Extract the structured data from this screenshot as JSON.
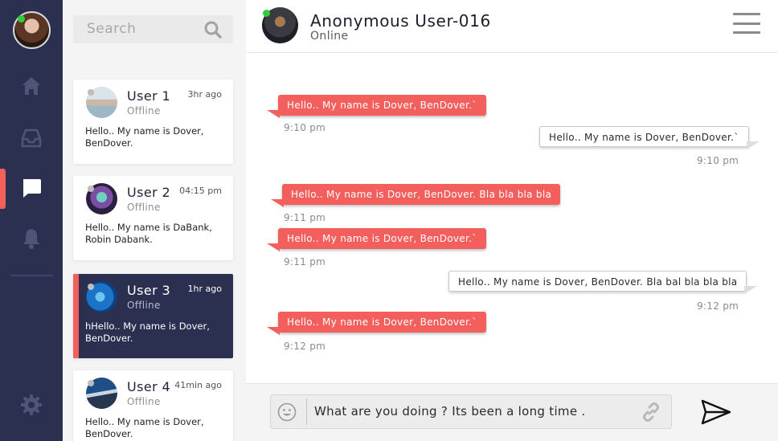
{
  "search": {
    "placeholder": "Search"
  },
  "conversations": [
    {
      "name": "User 1",
      "status": "Offline",
      "time": "3hr ago",
      "preview": "Hello.. My name is Dover, BenDover."
    },
    {
      "name": "User 2",
      "status": "Offline",
      "time": "04:15 pm",
      "preview": "Hello.. My name is DaBank, Robin Dabank."
    },
    {
      "name": "User 3",
      "status": "Offline",
      "time": "1hr ago",
      "preview": "hHello.. My name is Dover, BenDover."
    },
    {
      "name": "User 4",
      "status": "Offline",
      "time": "41min ago",
      "preview": "Hello.. My name is Dover, BenDover."
    }
  ],
  "chat": {
    "title": "Anonymous User-016",
    "presence": "Online",
    "messages": [
      {
        "direction": "in",
        "text": "Hello.. My name is Dover, BenDover.`",
        "time": "9:10 pm"
      },
      {
        "direction": "out",
        "text": "Hello.. My name is Dover, BenDover.`",
        "time": "9:10 pm"
      },
      {
        "direction": "in",
        "text": "Hello.. My name is Dover, BenDover. Bla bla bla bla",
        "time": "9:11 pm"
      },
      {
        "direction": "in",
        "text": "Hello.. My name is Dover, BenDover.`",
        "time": "9:11 pm"
      },
      {
        "direction": "out",
        "text": "Hello.. My name is Dover, BenDover. Bla bal bla bla bla",
        "time": "9:12 pm"
      },
      {
        "direction": "in",
        "text": "Hello.. My name is Dover, BenDover.`",
        "time": "9:12 pm"
      }
    ]
  },
  "composer": {
    "value": "What are you doing ? Its been a long time ."
  },
  "colors": {
    "rail": "#2b3050",
    "accent": "#f25f5c",
    "online": "#2ed03a",
    "offline": "#bdbdbd"
  },
  "icons": [
    "home-icon",
    "inbox-icon",
    "chat-bubble-icon",
    "bell-icon",
    "gear-icon",
    "search-icon",
    "emoji-icon",
    "link-icon",
    "send-icon",
    "menu-icon"
  ]
}
